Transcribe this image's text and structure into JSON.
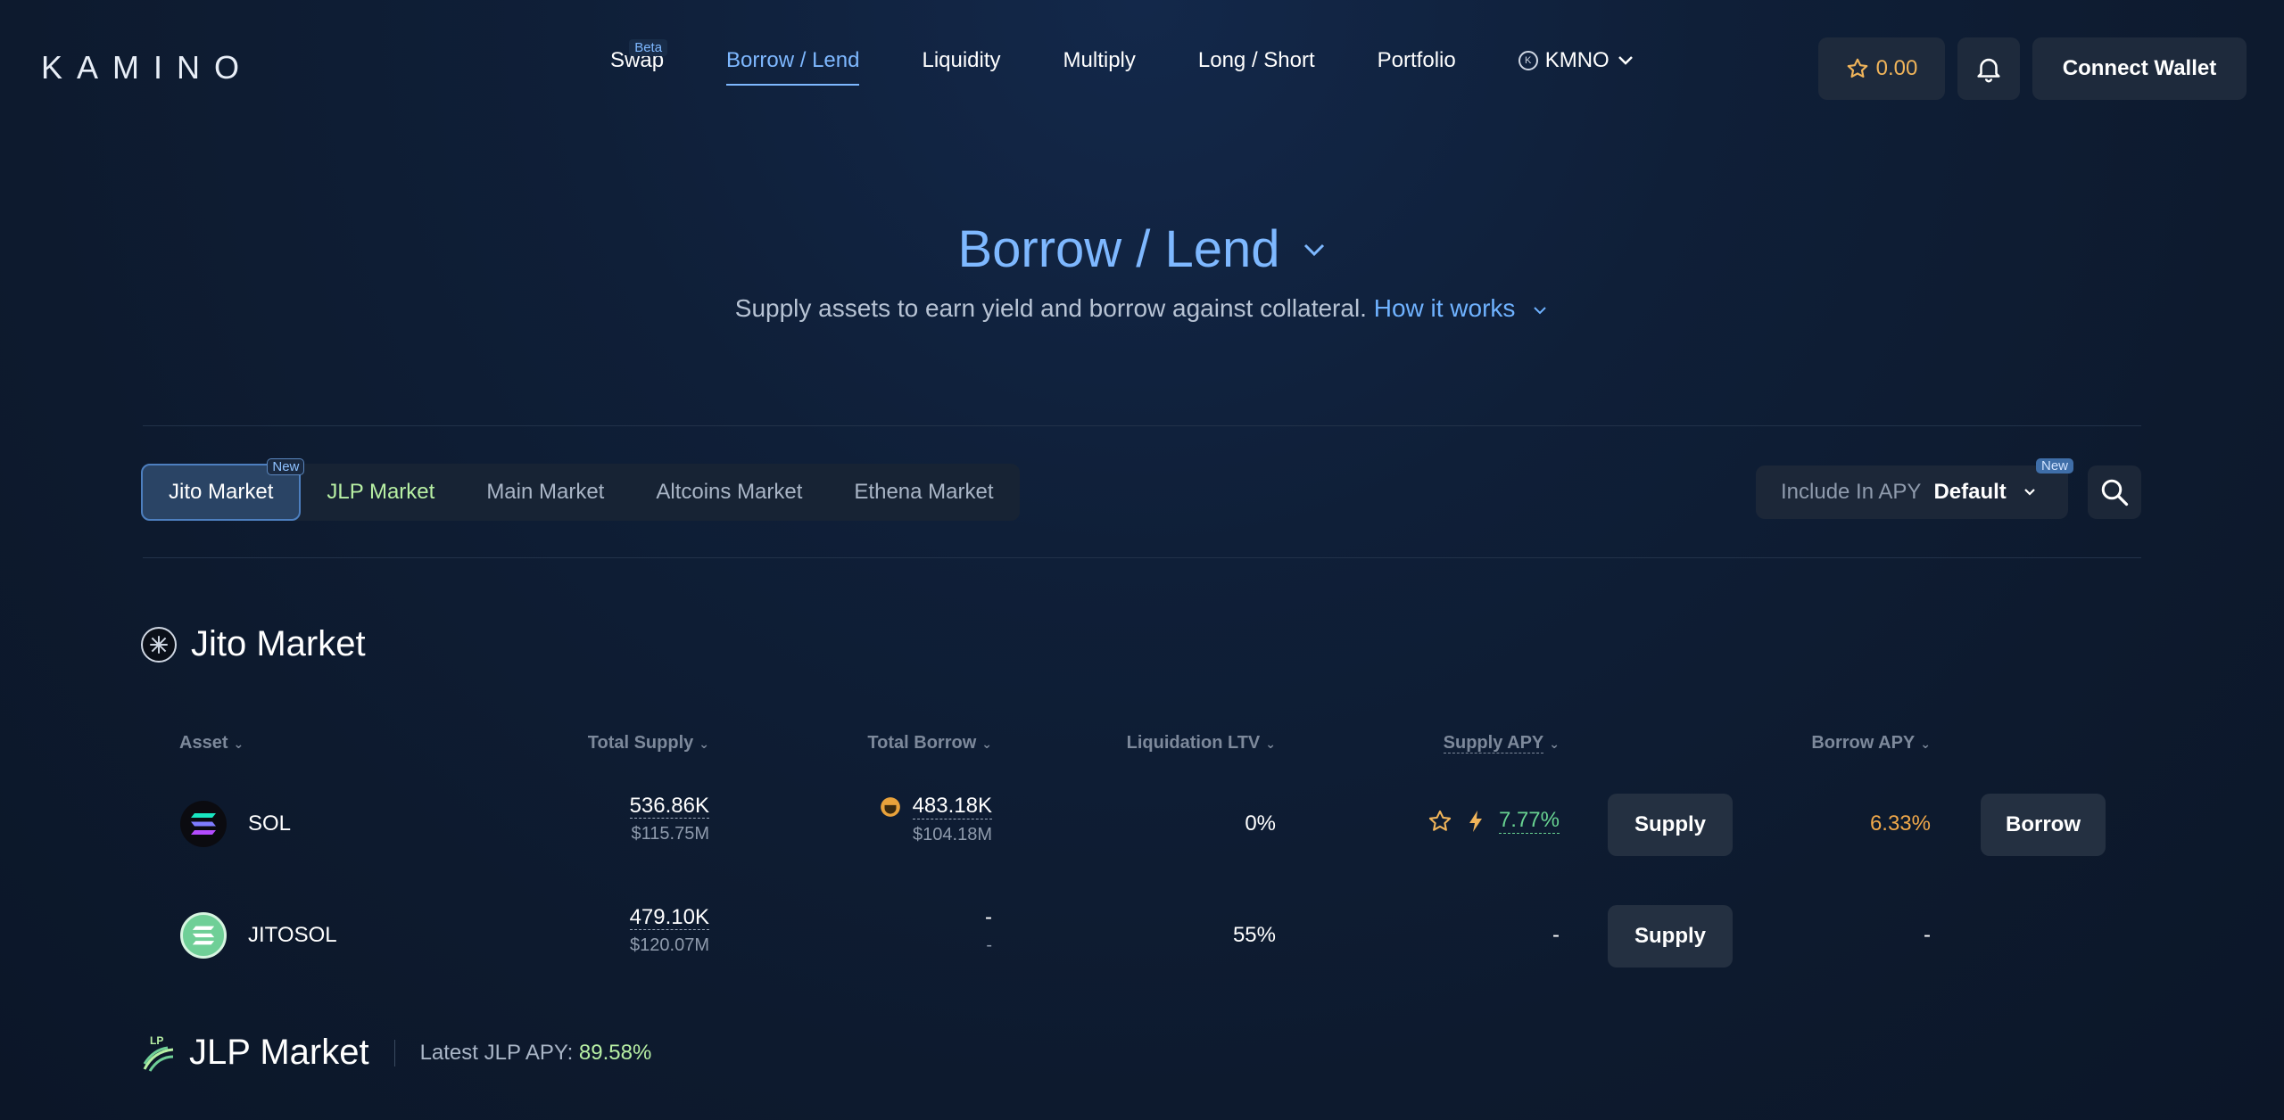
{
  "app": {
    "logo_text": "KAMINO"
  },
  "nav": {
    "items": [
      {
        "label": "Swap",
        "badge": "Beta"
      },
      {
        "label": "Borrow / Lend",
        "active": true
      },
      {
        "label": "Liquidity"
      },
      {
        "label": "Multiply"
      },
      {
        "label": "Long / Short"
      },
      {
        "label": "Portfolio"
      },
      {
        "label": "KMNO"
      }
    ]
  },
  "header": {
    "points": "0.00",
    "connect_label": "Connect Wallet"
  },
  "hero": {
    "title": "Borrow / Lend",
    "subtitle": "Supply assets to earn yield and borrow against collateral.",
    "link": "How it works"
  },
  "tabs": [
    {
      "label": "Jito Market",
      "active": true,
      "badge": "New"
    },
    {
      "label": "JLP Market"
    },
    {
      "label": "Main Market"
    },
    {
      "label": "Altcoins Market"
    },
    {
      "label": "Ethena Market"
    }
  ],
  "apy_filter": {
    "label": "Include In APY",
    "value": "Default",
    "badge": "New"
  },
  "jito_market": {
    "title": "Jito Market",
    "columns": [
      "Asset",
      "Total Supply",
      "Total Borrow",
      "Liquidation LTV",
      "Supply APY",
      "Borrow APY"
    ],
    "rows": [
      {
        "asset": "SOL",
        "total_supply": "536.86K",
        "total_supply_usd": "$115.75M",
        "total_borrow": "483.18K",
        "total_borrow_usd": "$104.18M",
        "ltv": "0%",
        "supply_apy": "7.77%",
        "supply_btn": "Supply",
        "borrow_apy": "6.33%",
        "borrow_btn": "Borrow"
      },
      {
        "asset": "JITOSOL",
        "total_supply": "479.10K",
        "total_supply_usd": "$120.07M",
        "total_borrow": "-",
        "total_borrow_usd": "-",
        "ltv": "55%",
        "supply_apy": "-",
        "supply_btn": "Supply",
        "borrow_apy": "-"
      }
    ]
  },
  "jlp_market": {
    "title": "JLP Market",
    "apy_label": "Latest JLP APY:",
    "apy_value": "89.58%"
  },
  "colors": {
    "accent": "#7eb8ff",
    "green": "#68d391",
    "orange": "#f0a84a",
    "lime": "#b8f0a4"
  }
}
